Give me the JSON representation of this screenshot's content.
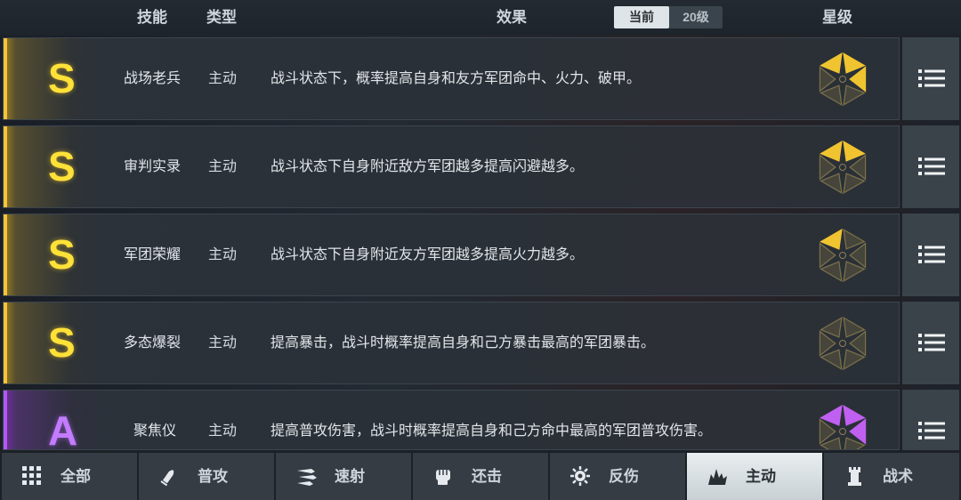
{
  "header": {
    "skill": "技能",
    "type": "类型",
    "effect": "效果",
    "toggle_current": "当前",
    "toggle_level": "20级",
    "star": "星级"
  },
  "skills": [
    {
      "rank": "S",
      "name": "战场老兵",
      "type": "主动",
      "effect": "战斗状态下，概率提高自身和友方军团命中、火力、破甲。",
      "star_filled": 3,
      "star_color": "#f0c430"
    },
    {
      "rank": "S",
      "name": "审判实录",
      "type": "主动",
      "effect": "战斗状态下自身附近敌方军团越多提高闪避越多。",
      "star_filled": 2,
      "star_color": "#f0c430"
    },
    {
      "rank": "S",
      "name": "军团荣耀",
      "type": "主动",
      "effect": "战斗状态下自身附近友方军团越多提高火力越多。",
      "star_filled": 1,
      "star_color": "#f0c430"
    },
    {
      "rank": "S",
      "name": "多态爆裂",
      "type": "主动",
      "effect": "提高暴击，战斗时概率提高自身和己方暴击最高的军团暴击。",
      "star_filled": 0,
      "star_color": "#f0c430"
    },
    {
      "rank": "A",
      "name": "聚焦仪",
      "type": "主动",
      "effect": "提高普攻伤害，战斗时概率提高自身和己方命中最高的军团普攻伤害。",
      "star_filled": 3,
      "star_color": "#c060f0"
    }
  ],
  "tabs": [
    {
      "label": "全部",
      "icon": "grid-icon"
    },
    {
      "label": "普攻",
      "icon": "bullet-icon"
    },
    {
      "label": "速射",
      "icon": "rapid-fire-icon"
    },
    {
      "label": "还击",
      "icon": "fist-icon"
    },
    {
      "label": "反伤",
      "icon": "gear-spike-icon"
    },
    {
      "label": "主动",
      "icon": "burst-icon",
      "active": true
    },
    {
      "label": "战术",
      "icon": "tower-icon"
    }
  ]
}
